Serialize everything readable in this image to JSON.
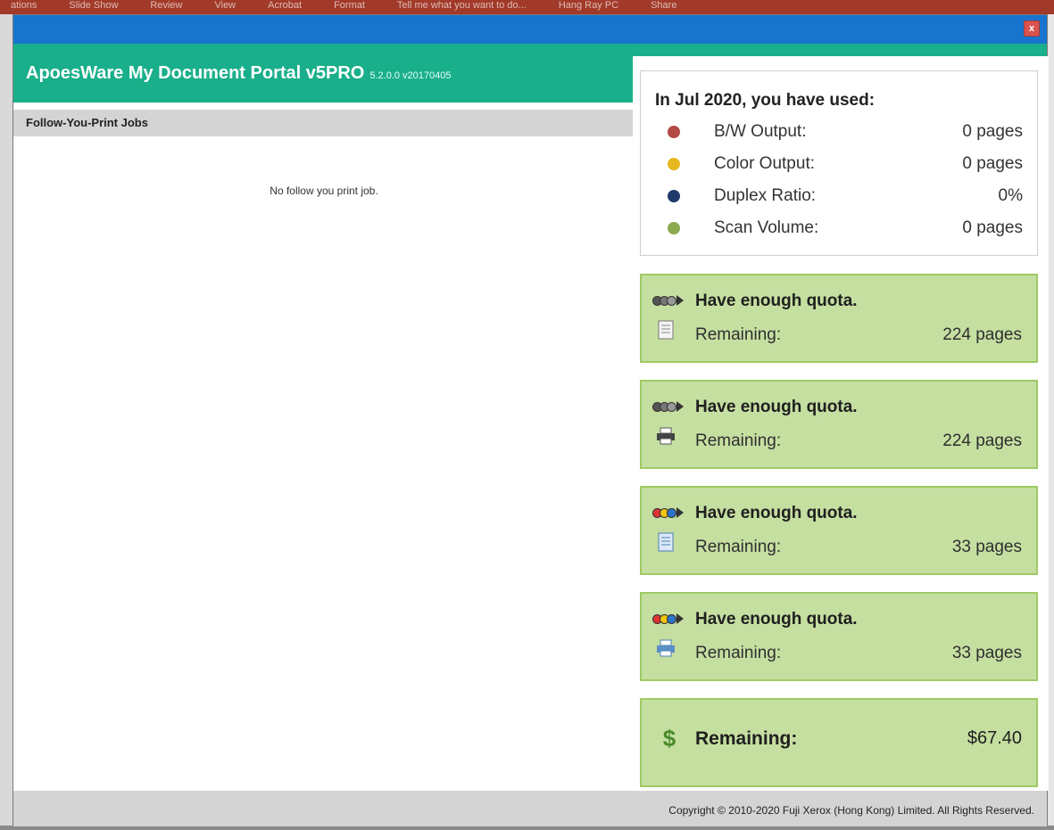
{
  "background_ribbon": {
    "items": [
      "ations",
      "Slide Show",
      "Review",
      "View",
      "Acrobat",
      "Format",
      "Tell me what you want to do...",
      "Hang Ray PC",
      "Share"
    ]
  },
  "dialog": {
    "close_icon": "x",
    "close_color": "#d9534f",
    "titlebar_color": "#1874cd"
  },
  "header": {
    "title": "ApoesWare My Document Portal v5PRO",
    "version": "5.2.0.0 v20170405",
    "background_color": "#1aaf8b"
  },
  "left_panel": {
    "section_title": "Follow-You-Print Jobs",
    "empty_message": "No follow you print job."
  },
  "usage": {
    "title": "In Jul 2020, you have used:",
    "rows": [
      {
        "label": "B/W Output:",
        "value": "0 pages",
        "color": "#b44a45"
      },
      {
        "label": "Color Output:",
        "value": "0 pages",
        "color": "#e6b820"
      },
      {
        "label": "Duplex Ratio:",
        "value": "0%",
        "color": "#1f3a6b"
      },
      {
        "label": "Scan Volume:",
        "value": "0 pages",
        "color": "#8bab4f"
      }
    ]
  },
  "quota_cards": [
    {
      "status": "Have enough quota.",
      "remaining_label": "Remaining:",
      "remaining_value": "224 pages",
      "pill_colors": [
        "#555",
        "#777",
        "#999"
      ],
      "icon": "document-icon"
    },
    {
      "status": "Have enough quota.",
      "remaining_label": "Remaining:",
      "remaining_value": "224 pages",
      "pill_colors": [
        "#555",
        "#777",
        "#999"
      ],
      "icon": "printer-icon"
    },
    {
      "status": "Have enough quota.",
      "remaining_label": "Remaining:",
      "remaining_value": "33 pages",
      "pill_colors": [
        "#d33",
        "#f1c40f",
        "#2c73c9"
      ],
      "icon": "color-document-icon"
    },
    {
      "status": "Have enough quota.",
      "remaining_label": "Remaining:",
      "remaining_value": "33 pages",
      "pill_colors": [
        "#d33",
        "#f1c40f",
        "#2c73c9"
      ],
      "icon": "color-printer-icon"
    }
  ],
  "money": {
    "label": "Remaining:",
    "value": "$67.40",
    "icon": "dollar-icon"
  },
  "card_colors": {
    "background": "#c5dfa1",
    "border": "#9fca63"
  },
  "footer": {
    "copyright": "Copyright © 2010-2020 Fuji Xerox (Hong Kong) Limited. All Rights Reserved."
  }
}
